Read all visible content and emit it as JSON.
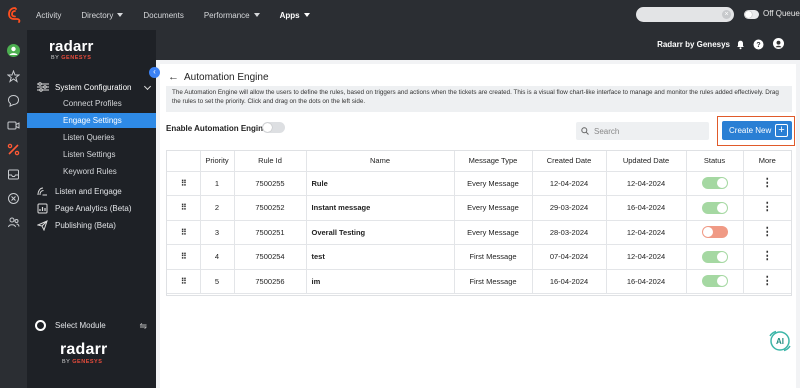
{
  "topbar": {
    "nav": [
      {
        "label": "Activity",
        "has_caret": false,
        "active": false
      },
      {
        "label": "Directory",
        "has_caret": true,
        "active": false
      },
      {
        "label": "Documents",
        "has_caret": false,
        "active": false
      },
      {
        "label": "Performance",
        "has_caret": true,
        "active": false
      },
      {
        "label": "Apps",
        "has_caret": true,
        "active": true
      }
    ],
    "search_placeholder": "",
    "queue_label": "Off Queue"
  },
  "sidebar": {
    "logo": "radarr",
    "logo_sub_prefix": "BY",
    "logo_sub_brand": "GENESYS",
    "section_label": "System Configuration",
    "sub_items": [
      {
        "label": "Connect Profiles",
        "active": false
      },
      {
        "label": "Engage Settings",
        "active": true
      },
      {
        "label": "Listen Queries",
        "active": false
      },
      {
        "label": "Listen Settings",
        "active": false
      },
      {
        "label": "Keyword Rules",
        "active": false
      }
    ],
    "items": [
      {
        "label": "Listen and Engage",
        "icon": "listen-engage-icon"
      },
      {
        "label": "Page Analytics (Beta)",
        "icon": "page-analytics-icon"
      },
      {
        "label": "Publishing (Beta)",
        "icon": "publishing-icon"
      }
    ],
    "select_module": "Select Module"
  },
  "header": {
    "org_name": "Radarr by Genesys"
  },
  "page": {
    "title": "Automation Engine",
    "description": "The Automation Engine will allow the users to define the rules, based on triggers and actions when the tickets are created. This is a visual flow chart-like interface to manage and monitor the rules added effectively. Drag the rules to set the priority. Click and drag on the dots on the left side.",
    "enable_label": "Enable Automation Engine",
    "enable_on": false,
    "search_placeholder": "Search",
    "create_label": "Create New",
    "create_plus": "+"
  },
  "table": {
    "columns": [
      "",
      "Priority",
      "Rule Id",
      "Name",
      "Message Type",
      "Created Date",
      "Updated Date",
      "Status",
      "More"
    ],
    "rows": [
      {
        "priority": "1",
        "rule_id": "7500255",
        "name": "Rule",
        "message_type": "Every Message",
        "created": "12-04-2024",
        "updated": "12-04-2024",
        "status_on": true
      },
      {
        "priority": "2",
        "rule_id": "7500252",
        "name": "Instant message",
        "message_type": "Every Message",
        "created": "29-03-2024",
        "updated": "16-04-2024",
        "status_on": true
      },
      {
        "priority": "3",
        "rule_id": "7500251",
        "name": "Overall Testing",
        "message_type": "Every Message",
        "created": "28-03-2024",
        "updated": "12-04-2024",
        "status_on": false
      },
      {
        "priority": "4",
        "rule_id": "7500254",
        "name": "test",
        "message_type": "First Message",
        "created": "07-04-2024",
        "updated": "12-04-2024",
        "status_on": true
      },
      {
        "priority": "5",
        "rule_id": "7500256",
        "name": "im",
        "message_type": "First Message",
        "created": "16-04-2024",
        "updated": "16-04-2024",
        "status_on": true
      }
    ]
  },
  "colors": {
    "accent": "#2a7fd4",
    "active_nav": "#2e8ae6",
    "highlight_border": "#e05a2a",
    "toggle_on": "#a5d8a2",
    "toggle_off": "#f09a85"
  }
}
